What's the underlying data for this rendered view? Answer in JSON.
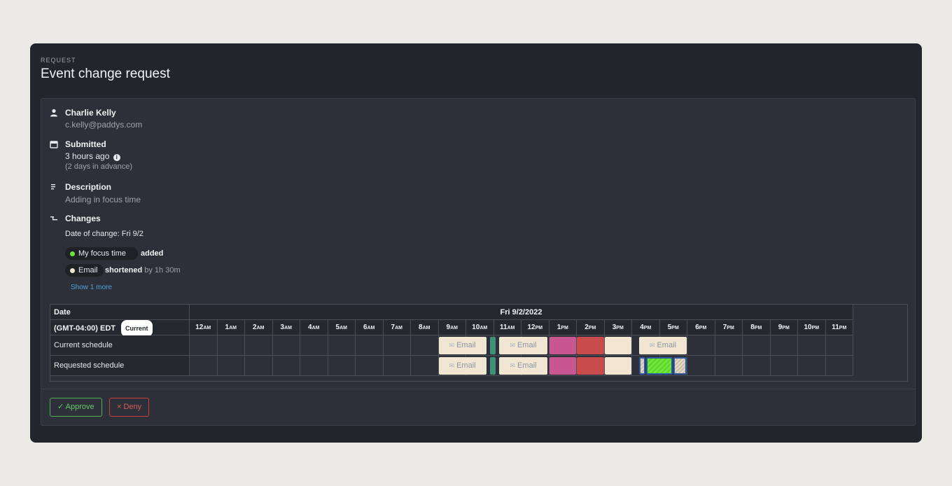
{
  "header": {
    "kicker": "REQUEST",
    "title": "Event change request"
  },
  "requester": {
    "name": "Charlie Kelly",
    "email": "c.kelly@paddys.com"
  },
  "submitted": {
    "label": "Submitted",
    "when": "3 hours ago",
    "advance": "(2 days in advance)"
  },
  "description": {
    "label": "Description",
    "text": "Adding in focus time"
  },
  "changes": {
    "label": "Changes",
    "date_of_change": "Date of change: Fri 9/2",
    "items": [
      {
        "event": "My focus time",
        "action": "added",
        "detail": "",
        "dot_color": "#6fe63a"
      },
      {
        "event": "Email",
        "action": "shortened",
        "detail": "by 1h 30m",
        "dot_color": "#f0e6d2"
      }
    ],
    "show_more": "Show 1 more"
  },
  "schedule": {
    "date_header": "Date",
    "day": "Fri 9/2/2022",
    "timezone": "(GMT-04:00) EDT",
    "tz_badge": "Current",
    "hours": [
      {
        "n": "12",
        "s": "AM"
      },
      {
        "n": "1",
        "s": "AM"
      },
      {
        "n": "2",
        "s": "AM"
      },
      {
        "n": "3",
        "s": "AM"
      },
      {
        "n": "4",
        "s": "AM"
      },
      {
        "n": "5",
        "s": "AM"
      },
      {
        "n": "6",
        "s": "AM"
      },
      {
        "n": "7",
        "s": "AM"
      },
      {
        "n": "8",
        "s": "AM"
      },
      {
        "n": "9",
        "s": "AM"
      },
      {
        "n": "10",
        "s": "AM"
      },
      {
        "n": "11",
        "s": "AM"
      },
      {
        "n": "12",
        "s": "PM"
      },
      {
        "n": "1",
        "s": "PM"
      },
      {
        "n": "2",
        "s": "PM"
      },
      {
        "n": "3",
        "s": "PM"
      },
      {
        "n": "4",
        "s": "PM"
      },
      {
        "n": "5",
        "s": "PM"
      },
      {
        "n": "6",
        "s": "PM"
      },
      {
        "n": "7",
        "s": "PM"
      },
      {
        "n": "8",
        "s": "PM"
      },
      {
        "n": "9",
        "s": "PM"
      },
      {
        "n": "10",
        "s": "PM"
      },
      {
        "n": "11",
        "s": "PM"
      }
    ],
    "rows": [
      {
        "label": "Current schedule",
        "events": [
          {
            "start": 9.0,
            "end": 10.75,
            "style": "beige",
            "text": "Email"
          },
          {
            "start": 10.85,
            "end": 11.1,
            "style": "teal",
            "text": ""
          },
          {
            "start": 11.2,
            "end": 12.95,
            "style": "beige",
            "text": "Email"
          },
          {
            "start": 13.0,
            "end": 14.0,
            "style": "pink",
            "text": ""
          },
          {
            "start": 14.0,
            "end": 15.0,
            "style": "red",
            "text": ""
          },
          {
            "start": 15.0,
            "end": 16.0,
            "style": "beige",
            "text": ""
          },
          {
            "start": 16.25,
            "end": 18.0,
            "style": "beige",
            "text": "Email"
          }
        ]
      },
      {
        "label": "Requested schedule",
        "events": [
          {
            "start": 9.0,
            "end": 10.75,
            "style": "beige",
            "text": "Email"
          },
          {
            "start": 10.85,
            "end": 11.1,
            "style": "teal",
            "text": ""
          },
          {
            "start": 11.2,
            "end": 12.95,
            "style": "beige",
            "text": "Email"
          },
          {
            "start": 13.0,
            "end": 14.0,
            "style": "pink",
            "text": ""
          },
          {
            "start": 14.0,
            "end": 15.0,
            "style": "red",
            "text": ""
          },
          {
            "start": 15.0,
            "end": 16.0,
            "style": "beige",
            "text": ""
          },
          {
            "start": 16.25,
            "end": 16.5,
            "style": "hatch",
            "text": ""
          },
          {
            "start": 16.5,
            "end": 17.5,
            "style": "green",
            "text": ""
          },
          {
            "start": 17.5,
            "end": 18.0,
            "style": "hatch",
            "text": ""
          }
        ]
      }
    ]
  },
  "actions": {
    "approve": "✓ Approve",
    "deny": "× Deny"
  },
  "icons": {
    "person": "person-icon",
    "calendar": "calendar-icon",
    "description": "lines-icon",
    "changes": "changes-icon",
    "info": "info-icon",
    "email_event": "email-event-icon"
  }
}
